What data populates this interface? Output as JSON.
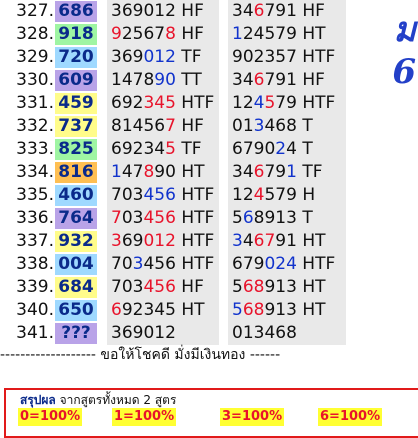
{
  "colors": {
    "result_backgrounds": {
      "yellow": "#fffc8a",
      "green": "#9ff5a3",
      "blue": "#9fd9ff",
      "purple": "#b9a3e8",
      "orange": "#ffbf52"
    },
    "red": "#e8132b",
    "blue_digit": "#1133cc"
  },
  "rows": [
    {
      "num": "327.",
      "result": "686",
      "bg": "purple",
      "f1": [
        [
          "369012",
          "k"
        ],
        [
          " HF",
          "k"
        ]
      ],
      "f2": [
        [
          "34",
          "k"
        ],
        [
          "6",
          "r"
        ],
        [
          "791",
          "k"
        ],
        [
          " HF",
          "k"
        ]
      ]
    },
    {
      "num": "328.",
      "result": "918",
      "bg": "green",
      "f1": [
        [
          "9",
          "r"
        ],
        [
          "2567",
          "k"
        ],
        [
          "8",
          "r"
        ],
        [
          " HF",
          "k"
        ]
      ],
      "f2": [
        [
          "1",
          "b"
        ],
        [
          "24579",
          "k"
        ],
        [
          " HT",
          "k"
        ]
      ]
    },
    {
      "num": "329.",
      "result": "720",
      "bg": "blue",
      "f1": [
        [
          "369",
          "k"
        ],
        [
          "012",
          "b"
        ],
        [
          " TF",
          "k"
        ]
      ],
      "f2": [
        [
          "902357",
          "k"
        ],
        [
          " HTF",
          "k"
        ]
      ]
    },
    {
      "num": "330.",
      "result": "609",
      "bg": "purple",
      "f1": [
        [
          "1478",
          "k"
        ],
        [
          "90",
          "b"
        ],
        [
          " TT",
          "k"
        ]
      ],
      "f2": [
        [
          "34",
          "k"
        ],
        [
          "6",
          "r"
        ],
        [
          "791",
          "k"
        ],
        [
          " HF",
          "k"
        ]
      ]
    },
    {
      "num": "331.",
      "result": "459",
      "bg": "yellow",
      "f1": [
        [
          "692",
          "k"
        ],
        [
          "345",
          "r"
        ],
        [
          " HTF",
          "k"
        ]
      ],
      "f2": [
        [
          "12",
          "k"
        ],
        [
          "4",
          "b"
        ],
        [
          "5",
          "r"
        ],
        [
          "79",
          "k"
        ],
        [
          " HTF",
          "k"
        ]
      ]
    },
    {
      "num": "332.",
      "result": "737",
      "bg": "yellow",
      "f1": [
        [
          "81456",
          "k"
        ],
        [
          "7",
          "r"
        ],
        [
          " HF",
          "k"
        ]
      ],
      "f2": [
        [
          "01",
          "k"
        ],
        [
          "3",
          "b"
        ],
        [
          "468",
          "k"
        ],
        [
          " T",
          "k"
        ]
      ]
    },
    {
      "num": "333.",
      "result": "825",
      "bg": "green",
      "f1": [
        [
          "692",
          "k"
        ],
        [
          "3",
          "k"
        ],
        [
          "4",
          "k"
        ],
        [
          "5",
          "r"
        ],
        [
          " TF",
          "k"
        ]
      ],
      "f2": [
        [
          "6790",
          "k"
        ],
        [
          "2",
          "b"
        ],
        [
          "4",
          "k"
        ],
        [
          " T",
          "k"
        ]
      ]
    },
    {
      "num": "334.",
      "result": "816",
      "bg": "orange",
      "f1": [
        [
          "1",
          "b"
        ],
        [
          "47",
          "k"
        ],
        [
          "8",
          "r"
        ],
        [
          "90",
          "k"
        ],
        [
          " HT",
          "k"
        ]
      ],
      "f2": [
        [
          "34",
          "k"
        ],
        [
          "6",
          "r"
        ],
        [
          "79",
          "k"
        ],
        [
          "1",
          "b"
        ],
        [
          " TF",
          "k"
        ]
      ]
    },
    {
      "num": "335.",
      "result": "460",
      "bg": "blue",
      "f1": [
        [
          "70",
          "k"
        ],
        [
          "3",
          "k"
        ],
        [
          "456",
          "b"
        ],
        [
          " HTF",
          "k"
        ]
      ],
      "f2": [
        [
          "12",
          "k"
        ],
        [
          "4",
          "r"
        ],
        [
          "579",
          "k"
        ],
        [
          " H",
          "k"
        ]
      ]
    },
    {
      "num": "336.",
      "result": "764",
      "bg": "purple",
      "f1": [
        [
          "7",
          "r"
        ],
        [
          "03",
          "k"
        ],
        [
          "456",
          "r"
        ],
        [
          " HTF",
          "k"
        ]
      ],
      "f2": [
        [
          "5",
          "k"
        ],
        [
          "6",
          "b"
        ],
        [
          "8913",
          "k"
        ],
        [
          " T",
          "k"
        ]
      ]
    },
    {
      "num": "337.",
      "result": "932",
      "bg": "yellow",
      "f1": [
        [
          "3",
          "r"
        ],
        [
          "69",
          "k"
        ],
        [
          "012",
          "r"
        ],
        [
          " HTF",
          "k"
        ]
      ],
      "f2": [
        [
          "3",
          "b"
        ],
        [
          "4",
          "k"
        ],
        [
          "67",
          "r"
        ],
        [
          "91",
          "k"
        ],
        [
          " HT",
          "k"
        ]
      ]
    },
    {
      "num": "338.",
      "result": "004",
      "bg": "blue",
      "f1": [
        [
          "70",
          "k"
        ],
        [
          "3",
          "b"
        ],
        [
          "456",
          "k"
        ],
        [
          " HTF",
          "k"
        ]
      ],
      "f2": [
        [
          "679",
          "k"
        ],
        [
          "024",
          "b"
        ],
        [
          " HTF",
          "k"
        ]
      ]
    },
    {
      "num": "339.",
      "result": "684",
      "bg": "yellow",
      "f1": [
        [
          "703",
          "k"
        ],
        [
          "456",
          "r"
        ],
        [
          " HF",
          "k"
        ]
      ],
      "f2": [
        [
          "5",
          "k"
        ],
        [
          "68",
          "r"
        ],
        [
          "913",
          "k"
        ],
        [
          " HT",
          "k"
        ]
      ]
    },
    {
      "num": "340.",
      "result": "650",
      "bg": "blue",
      "f1": [
        [
          "6",
          "r"
        ],
        [
          "92345",
          "k"
        ],
        [
          " HT",
          "k"
        ]
      ],
      "f2": [
        [
          "5",
          "b"
        ],
        [
          "68",
          "r"
        ],
        [
          "913",
          "k"
        ],
        [
          " HT",
          "k"
        ]
      ]
    },
    {
      "num": "341.",
      "result": "???",
      "bg": "purple",
      "f1": [
        [
          "369012",
          "k"
        ]
      ],
      "f2": [
        [
          "013468",
          "k"
        ]
      ]
    }
  ],
  "side_glyphs": [
    "ม",
    "6"
  ],
  "divider_text": "------------------- ขอให้โชคดี มั่งมีเงินทอง ------",
  "summary": {
    "title_bold": "สรุปผล",
    "title_rest": " จากสูตรทั้งหมด 2 สูตร",
    "stats": [
      "0=100%",
      "1=100%",
      "3=100%",
      "6=100%"
    ]
  }
}
